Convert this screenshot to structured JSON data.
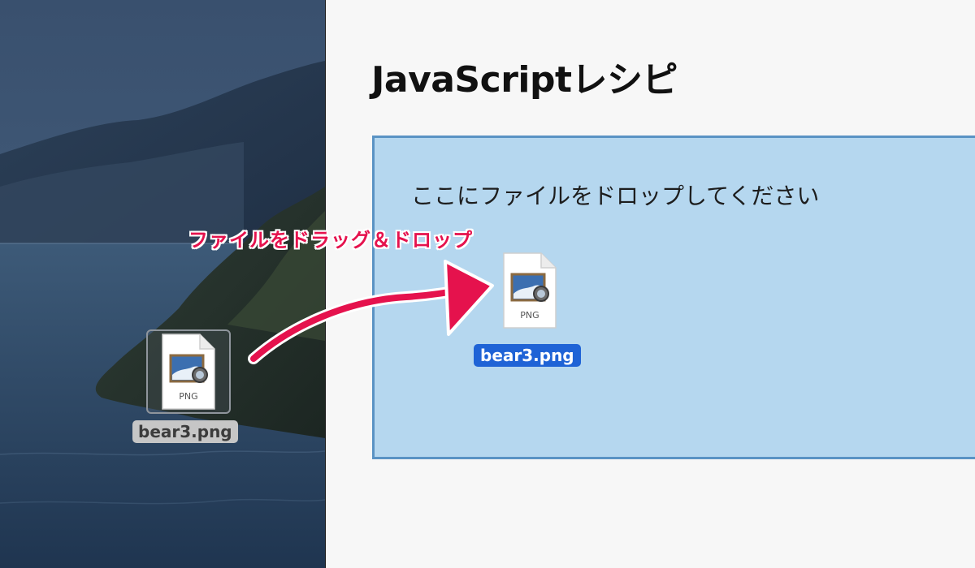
{
  "page": {
    "title": "JavaScriptレシピ",
    "drop_zone_text": "ここにファイルをドロップしてください"
  },
  "annotation": {
    "text": "ファイルをドラッグ＆ドロップ",
    "color": "#e5124d"
  },
  "desktop_file": {
    "name": "bear3.png",
    "type_label": "PNG",
    "icon": "png-file-icon"
  },
  "dragged_file": {
    "name": "bear3.png",
    "type_label": "PNG",
    "icon": "png-file-icon"
  },
  "colors": {
    "drop_zone_bg": "#b5d7ef",
    "drop_zone_border": "#5a93c4",
    "selection_label": "#1f63d6",
    "page_bg": "#f7f7f7"
  }
}
